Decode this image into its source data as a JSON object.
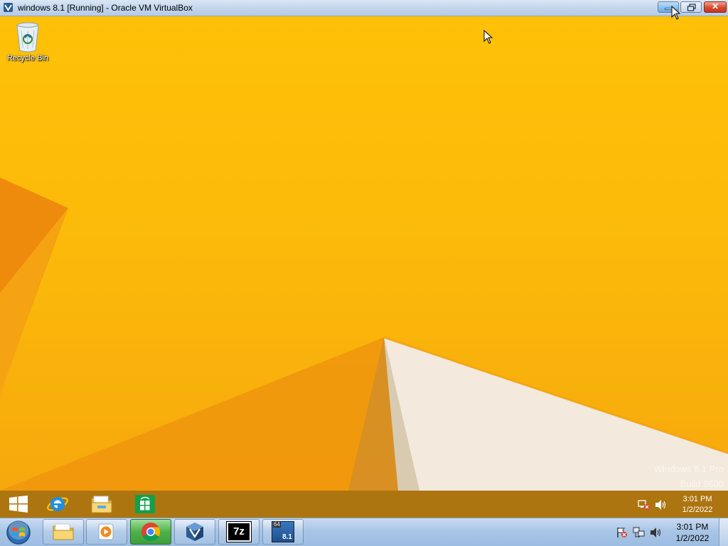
{
  "host_window": {
    "title": "windows 8.1 [Running] - Oracle VM VirtualBox",
    "close_glyph": "✕"
  },
  "desktop": {
    "icons": [
      {
        "label": "Recycle Bin",
        "icon": "recycle-bin-icon"
      }
    ],
    "watermark": {
      "line1": "Windows 8.1 Pro",
      "line2": "Build 9600"
    }
  },
  "guest_taskbar": {
    "items": [
      "start-icon",
      "internet-explorer-icon",
      "file-explorer-icon",
      "windows-store-icon"
    ],
    "tray": [
      "network-disconnected-icon",
      "volume-icon"
    ],
    "clock": {
      "time": "3:01 PM",
      "date": "1/2/2022"
    }
  },
  "host_taskbar": {
    "items": [
      "file-explorer-icon",
      "media-player-icon",
      "chrome-icon",
      "virtualbox-icon",
      "7zip-icon",
      "windows-8-1-vm-icon"
    ],
    "active": "chrome-icon",
    "sevenzip_label": "7z",
    "vm_badge_top": "64",
    "vm_badge_bottom": "8.1",
    "tray": [
      "action-center-icon",
      "network-icon",
      "volume-icon"
    ],
    "clock": {
      "time": "3:01 PM",
      "date": "1/2/2022"
    }
  },
  "colors": {
    "wallpaper_main": "#ffc107",
    "wallpaper_dark": "#ef8a0b",
    "host_taskbar": "#a9c5e6"
  }
}
